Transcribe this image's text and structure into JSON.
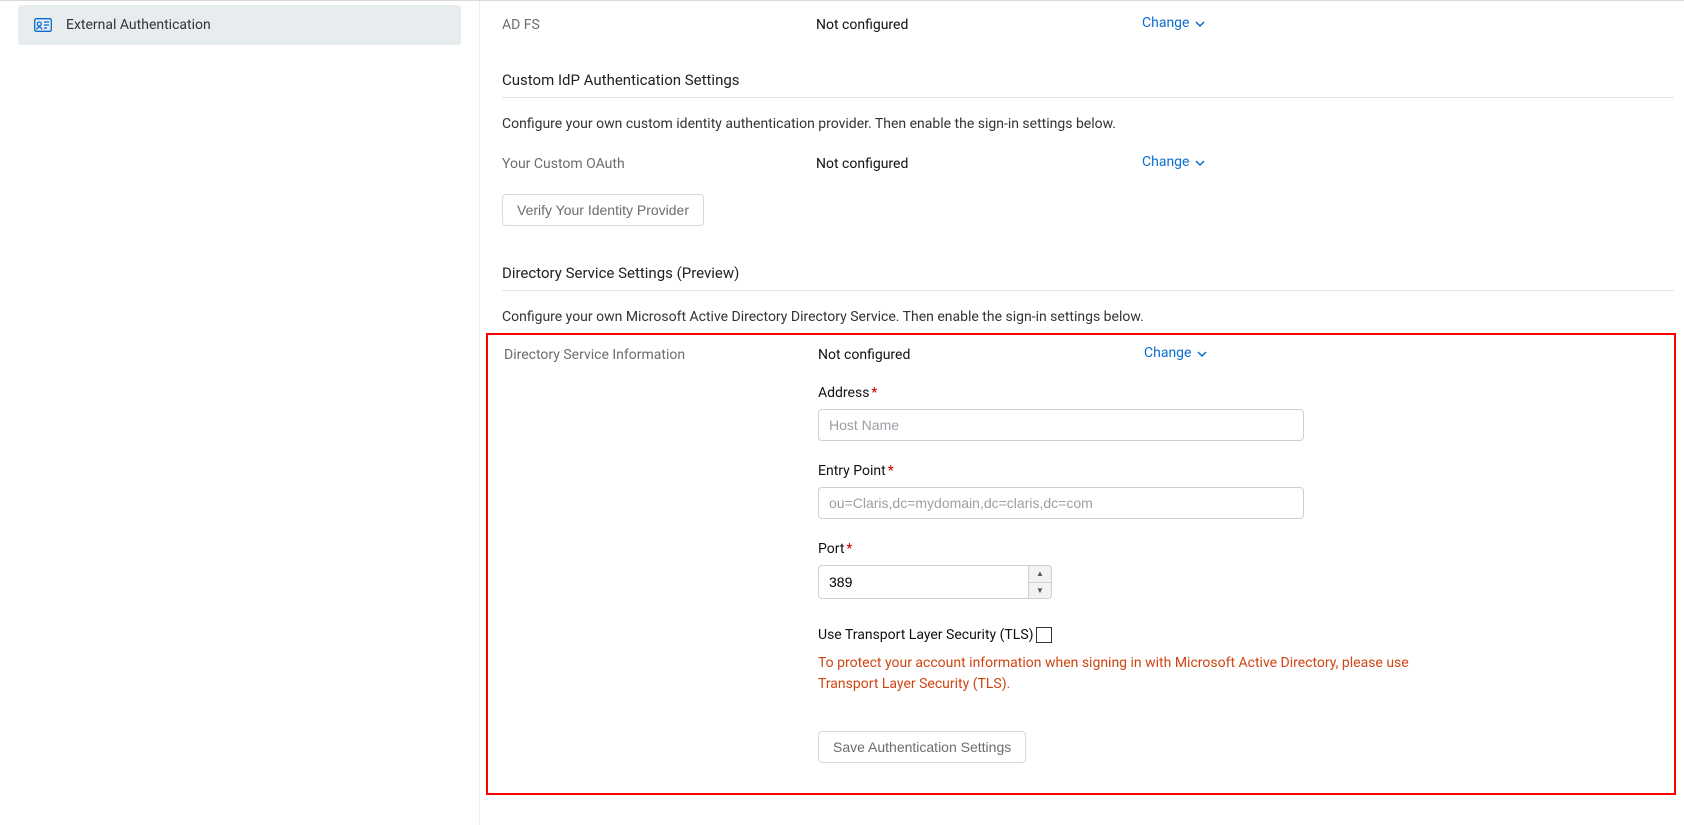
{
  "sidebar": {
    "active_item": {
      "label": "External Authentication"
    }
  },
  "adfs": {
    "label": "AD FS",
    "status": "Not configured",
    "action": "Change"
  },
  "custom_idp": {
    "heading": "Custom IdP Authentication Settings",
    "description": "Configure your own custom identity authentication provider. Then enable the sign-in settings below.",
    "label": "Your Custom OAuth",
    "status": "Not configured",
    "action": "Change",
    "verify_button": "Verify Your Identity Provider"
  },
  "directory": {
    "heading": "Directory Service Settings (Preview)",
    "description": "Configure your own Microsoft Active Directory Directory Service. Then enable the sign-in settings below.",
    "label": "Directory Service Information",
    "status": "Not configured",
    "action": "Change",
    "address_label": "Address",
    "address_placeholder": "Host Name",
    "address_value": "",
    "entry_label": "Entry Point",
    "entry_placeholder": "ou=Claris,dc=mydomain,dc=claris,dc=com",
    "entry_value": "",
    "port_label": "Port",
    "port_value": "389",
    "tls_label": "Use Transport Layer Security (TLS)",
    "tls_warning": "To protect your account information when signing in with Microsoft Active Directory, please use Transport Layer Security (TLS).",
    "save_button": "Save Authentication Settings"
  }
}
